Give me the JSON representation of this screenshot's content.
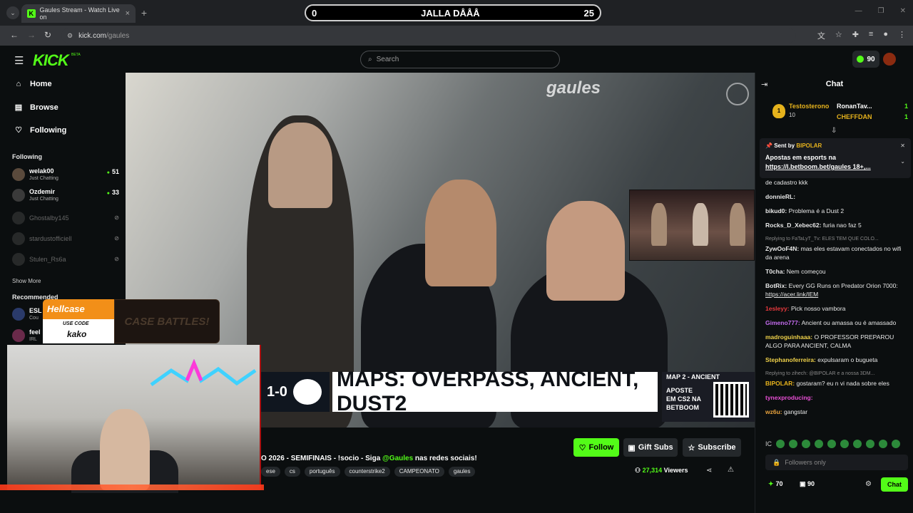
{
  "browser": {
    "tab_title": "Gaules Stream - Watch Live on",
    "tab_favicon": "K",
    "tab_close": "×",
    "tab_list_icon": "⌄",
    "new_tab": "+",
    "url": "kick.com/gaules",
    "url_host": "kick.com",
    "url_path": "/gaules",
    "back": "←",
    "forward": "→",
    "reload": "↻",
    "minimize": "—",
    "restore": "❐",
    "close": "✕"
  },
  "scorebar": {
    "left": "0",
    "center": "JALLA DÅÅÅ",
    "right": "25"
  },
  "header": {
    "logo": "KICK",
    "logo_beta": "BETA",
    "search_placeholder": "Search",
    "points": "90"
  },
  "sidebar": {
    "nav": [
      {
        "label": "Home",
        "icon": "home-icon"
      },
      {
        "label": "Browse",
        "icon": "browse-icon"
      },
      {
        "label": "Following",
        "icon": "heart-icon"
      }
    ],
    "following_title": "Following",
    "following": [
      {
        "name": "welak00",
        "category": "Just Chatting",
        "viewers": "51",
        "live": true
      },
      {
        "name": "Ozdemir",
        "category": "Just Chatting",
        "viewers": "33",
        "live": true
      },
      {
        "name": "Ghostalby145",
        "live": false
      },
      {
        "name": "stardustofficiell",
        "live": false
      },
      {
        "name": "Stulen_Rs6a",
        "live": false
      }
    ],
    "show_more": "Show More",
    "recommended_title": "Recommended",
    "recommended": [
      {
        "name": "ESL",
        "category": "Cou"
      },
      {
        "name": "feel",
        "category": "IRL"
      }
    ]
  },
  "video": {
    "watermark": "gaules",
    "score": "1-0",
    "maps_text": "MAPS: OVERPASS, ANCIENT, DUST2",
    "map2_title": "MAP 2 - ANCIENT",
    "map2_cta": [
      "APOSTE",
      "EM CS2 NA",
      "BETBOOM"
    ]
  },
  "ad": {
    "brand": "Hellcase",
    "use_code_label": "USE CODE",
    "code": "kako",
    "right_text": "CASE BATTLES!"
  },
  "stream_info": {
    "title_prefix": "O 2026 - SEMIFINAIS - !socio - Siga ",
    "title_mention": "@Gaules",
    "title_suffix": " nas redes sociais!",
    "tags": [
      "ese",
      "cs",
      "português",
      "counterstrike2",
      "CAMPEONATO",
      "gaules"
    ],
    "follow_label": "Follow",
    "giftsubs_label": "Gift Subs",
    "subscribe_label": "Subscribe",
    "viewers_count": "27,314",
    "viewers_label": "Viewers"
  },
  "chat": {
    "title": "Chat",
    "leaderboard": {
      "first_rank": "1",
      "first_name": "Testosterono",
      "first_count": "10",
      "others": [
        {
          "name": "RonanTav...",
          "count": "1",
          "color": "#ffffff"
        },
        {
          "name": "CHEFFDAN",
          "count": "1",
          "color": "#e6b21c"
        }
      ]
    },
    "pinned": {
      "sent_by_label": "Sent by",
      "user": "BIPOLAR",
      "message": "Apostas em esports na",
      "link": "https://l.betboom.bet/gaules 18+,..."
    },
    "messages": [
      {
        "user": "",
        "color": "#e8e8e8",
        "text": "de cadastro kkk",
        "reply": ""
      },
      {
        "user": "donnieRL:",
        "color": "#e8e8e8",
        "text": "",
        "reply": ""
      },
      {
        "user": "bikud0:",
        "color": "#e8e8e8",
        "text": "Problema é a Dust 2",
        "reply": ""
      },
      {
        "user": "Rocks_D_Xebec62:",
        "color": "#e8e8e8",
        "text": "furia nao faz 5",
        "reply": ""
      },
      {
        "user": "ZywOoF4N:",
        "color": "#e8e8e8",
        "text": "mas eles estavam conectados no wifi da arena",
        "reply": "Replying to FaTaLyT_Tv: ELES TEM QUE COLO..."
      },
      {
        "user": "T0cha:",
        "color": "#e8e8e8",
        "text": "Nem começou",
        "reply": ""
      },
      {
        "user": "BotRix:",
        "color": "#e8e8e8",
        "text": "Every GG Runs on Predator Orion 7000: ",
        "link": "https://acer.link/IEM",
        "reply": ""
      },
      {
        "user": "1esleyy:",
        "color": "#e8393d",
        "text": "Pick nosso vambora",
        "reply": ""
      },
      {
        "user": "Gimeno777:",
        "color": "#c56cf0",
        "text": "Ancient ou amassa ou é amassado",
        "reply": ""
      },
      {
        "user": "madroguinhaaa:",
        "color": "#f0d24a",
        "text": "O PROFESSOR PREPAROU ALGO PARA ANCIENT, CALMA",
        "reply": ""
      },
      {
        "user": "Stephanoferreira:",
        "color": "#f0d24a",
        "text": "expulsaram o bugueta",
        "reply": ""
      },
      {
        "user": "BIPOLAR:",
        "color": "#e6b21c",
        "text": "gostaram? eu n vi nada sobre eles",
        "reply": "Replying to zihech: @BIPOLAR e a nossa 3DM..."
      },
      {
        "user": "tynexproducing:",
        "color": "#e94fd6",
        "text": "",
        "reply": ""
      },
      {
        "user": "wz6u:",
        "color": "#e8a23d",
        "text": "gangstar",
        "reply": ""
      }
    ],
    "input_placeholder": "Followers only",
    "points": "70",
    "subs": "90",
    "send_label": "Chat"
  }
}
